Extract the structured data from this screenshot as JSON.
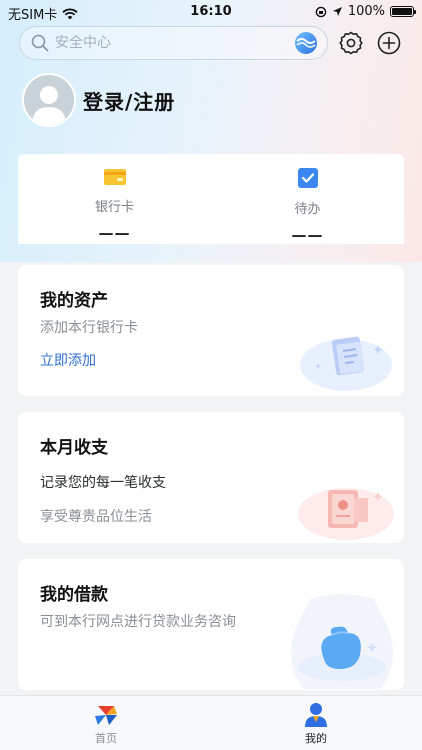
{
  "status_bar": {
    "carrier": "无SIM卡",
    "time": "16:10",
    "battery_percent": "100%",
    "battery_level": 1.0
  },
  "search": {
    "placeholder": "安全中心"
  },
  "profile": {
    "login_label": "登录/注册"
  },
  "quick_items": [
    {
      "label": "银行卡",
      "value": "——",
      "icon": "bank-card-icon"
    },
    {
      "label": "待办",
      "value": "——",
      "icon": "todo-check-icon"
    }
  ],
  "cards": {
    "assets": {
      "title": "我的资产",
      "subtitle": "添加本行银行卡",
      "link": "立即添加"
    },
    "income": {
      "title": "本月收支",
      "line1": "记录您的每一笔收支",
      "line2": "享受尊贵品位生活"
    },
    "loan": {
      "title": "我的借款",
      "subtitle": "可到本行网点进行贷款业务咨询"
    }
  },
  "tab_bar": {
    "tabs": [
      {
        "label": "首页",
        "active": false
      },
      {
        "label": "我的",
        "active": true
      }
    ]
  },
  "colors": {
    "link": "#2f6fd1",
    "active_tab": "#222222",
    "inactive_tab": "#8a8f96"
  }
}
